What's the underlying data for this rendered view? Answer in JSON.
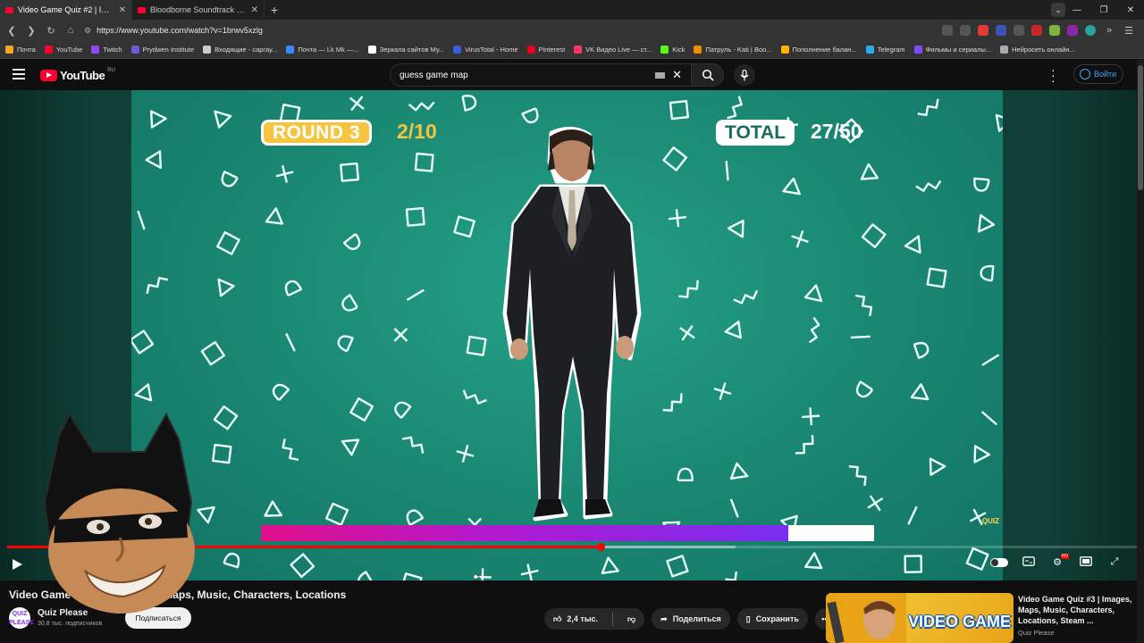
{
  "browser": {
    "tabs": [
      {
        "title": "Video Game Quiz #2 | Image",
        "active": true
      },
      {
        "title": "Bloodborne Soundtrack OST - M",
        "active": false
      }
    ],
    "url": "https://www.youtube.com/watch?v=1brwv5xzlg",
    "bookmarks": [
      {
        "label": "Почта",
        "color": "#f5a623"
      },
      {
        "label": "YouTube",
        "color": "#ff0033"
      },
      {
        "label": "Twitch",
        "color": "#9146ff"
      },
      {
        "label": "Prydwen Institute",
        "color": "#6b5bd6"
      },
      {
        "label": "Входящие - саргау...",
        "color": "#cccccc"
      },
      {
        "label": "Почта — Lk Mk —...",
        "color": "#3a86ff"
      },
      {
        "label": "Зеркала сайтов Му...",
        "color": "#ffffff"
      },
      {
        "label": "VirusTotal - Home",
        "color": "#3b5bdb"
      },
      {
        "label": "Pinterest",
        "color": "#e60023"
      },
      {
        "label": "VK Видео Live — ст...",
        "color": "#ff3366"
      },
      {
        "label": "Kick",
        "color": "#53fc18"
      },
      {
        "label": "Патруль - Kati | Boo...",
        "color": "#f08c00"
      },
      {
        "label": "Пополнение балан...",
        "color": "#ffb300"
      },
      {
        "label": "Telegram",
        "color": "#2aabee"
      },
      {
        "label": "Фильмы и сериалы...",
        "color": "#7c4dff"
      },
      {
        "label": "Нейросеть онлайн...",
        "color": "#aaaaaa"
      }
    ]
  },
  "youtube": {
    "logo_text": "YouTube",
    "region": "RU",
    "search_value": "guess game map",
    "signin_label": "Войти"
  },
  "video": {
    "round_label": "ROUND 3",
    "round_count": "2/10",
    "total_label": "TOTAL",
    "total_count": "27/50",
    "watermark": "QUIZ",
    "timer_progress": 0.86,
    "played_fraction": 0.525,
    "buffered_fraction": 0.645
  },
  "info": {
    "title": "Video Game Quiz #2 | Images, Maps, Music, Characters, Locations",
    "channel": "Quiz Please",
    "avatar_text": "QUIZ PLEASE",
    "subscribers": "30,8 тыс. подписчиков",
    "subscribe_label": "Подписаться",
    "likes": "2,4 тыс.",
    "share_label": "Поделиться",
    "save_label": "Сохранить"
  },
  "recommended": {
    "title": "Video Game Quiz #3 | Images, Maps, Music, Characters, Locations, Steam ...",
    "channel": "Quiz Please",
    "thumb_text": "VIDEO GAME"
  }
}
